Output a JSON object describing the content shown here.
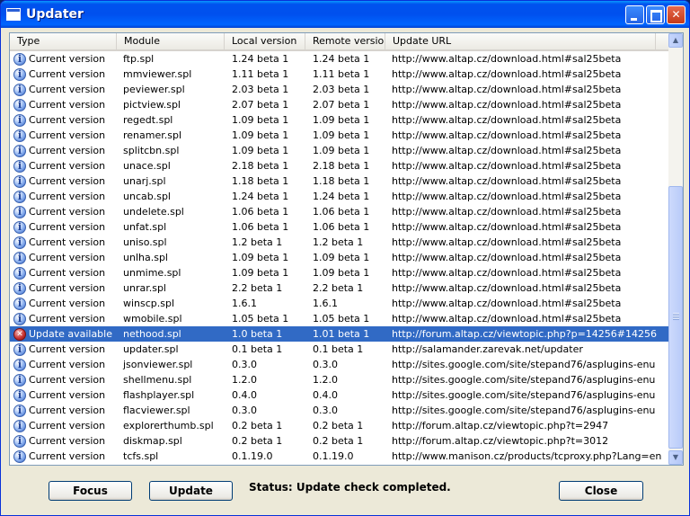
{
  "window": {
    "title": "Updater"
  },
  "titlebar": {
    "min": "",
    "max": "",
    "close": "✕"
  },
  "columns": [
    "Type",
    "Module",
    "Local version",
    "Remote version",
    "Update URL"
  ],
  "rows": [
    {
      "type": "Current version",
      "icon": "info-icon",
      "module": "ftp.spl",
      "local": "1.24 beta 1",
      "remote": "1.24 beta 1",
      "url": "http://www.altap.cz/download.html#sal25beta"
    },
    {
      "type": "Current version",
      "icon": "info-icon",
      "module": "mmviewer.spl",
      "local": "1.11 beta 1",
      "remote": "1.11 beta 1",
      "url": "http://www.altap.cz/download.html#sal25beta"
    },
    {
      "type": "Current version",
      "icon": "info-icon",
      "module": "peviewer.spl",
      "local": "2.03 beta 1",
      "remote": "2.03 beta 1",
      "url": "http://www.altap.cz/download.html#sal25beta"
    },
    {
      "type": "Current version",
      "icon": "info-icon",
      "module": "pictview.spl",
      "local": "2.07 beta 1",
      "remote": "2.07 beta 1",
      "url": "http://www.altap.cz/download.html#sal25beta"
    },
    {
      "type": "Current version",
      "icon": "info-icon",
      "module": "regedt.spl",
      "local": "1.09 beta 1",
      "remote": "1.09 beta 1",
      "url": "http://www.altap.cz/download.html#sal25beta"
    },
    {
      "type": "Current version",
      "icon": "info-icon",
      "module": "renamer.spl",
      "local": "1.09 beta 1",
      "remote": "1.09 beta 1",
      "url": "http://www.altap.cz/download.html#sal25beta"
    },
    {
      "type": "Current version",
      "icon": "info-icon",
      "module": "splitcbn.spl",
      "local": "1.09 beta 1",
      "remote": "1.09 beta 1",
      "url": "http://www.altap.cz/download.html#sal25beta"
    },
    {
      "type": "Current version",
      "icon": "info-icon",
      "module": "unace.spl",
      "local": "2.18 beta 1",
      "remote": "2.18 beta 1",
      "url": "http://www.altap.cz/download.html#sal25beta"
    },
    {
      "type": "Current version",
      "icon": "info-icon",
      "module": "unarj.spl",
      "local": "1.18 beta 1",
      "remote": "1.18 beta 1",
      "url": "http://www.altap.cz/download.html#sal25beta"
    },
    {
      "type": "Current version",
      "icon": "info-icon",
      "module": "uncab.spl",
      "local": "1.24 beta 1",
      "remote": "1.24 beta 1",
      "url": "http://www.altap.cz/download.html#sal25beta"
    },
    {
      "type": "Current version",
      "icon": "info-icon",
      "module": "undelete.spl",
      "local": "1.06 beta 1",
      "remote": "1.06 beta 1",
      "url": "http://www.altap.cz/download.html#sal25beta"
    },
    {
      "type": "Current version",
      "icon": "info-icon",
      "module": "unfat.spl",
      "local": "1.06 beta 1",
      "remote": "1.06 beta 1",
      "url": "http://www.altap.cz/download.html#sal25beta"
    },
    {
      "type": "Current version",
      "icon": "info-icon",
      "module": "uniso.spl",
      "local": "1.2 beta 1",
      "remote": "1.2 beta 1",
      "url": "http://www.altap.cz/download.html#sal25beta"
    },
    {
      "type": "Current version",
      "icon": "info-icon",
      "module": "unlha.spl",
      "local": "1.09 beta 1",
      "remote": "1.09 beta 1",
      "url": "http://www.altap.cz/download.html#sal25beta"
    },
    {
      "type": "Current version",
      "icon": "info-icon",
      "module": "unmime.spl",
      "local": "1.09 beta 1",
      "remote": "1.09 beta 1",
      "url": "http://www.altap.cz/download.html#sal25beta"
    },
    {
      "type": "Current version",
      "icon": "info-icon",
      "module": "unrar.spl",
      "local": "2.2 beta 1",
      "remote": "2.2 beta 1",
      "url": "http://www.altap.cz/download.html#sal25beta"
    },
    {
      "type": "Current version",
      "icon": "info-icon",
      "module": "winscp.spl",
      "local": "1.6.1",
      "remote": "1.6.1",
      "url": "http://www.altap.cz/download.html#sal25beta"
    },
    {
      "type": "Current version",
      "icon": "info-icon",
      "module": "wmobile.spl",
      "local": "1.05 beta 1",
      "remote": "1.05 beta 1",
      "url": "http://www.altap.cz/download.html#sal25beta"
    },
    {
      "type": "Update available",
      "icon": "error-icon",
      "module": "nethood.spl",
      "local": "1.0 beta 1",
      "remote": "1.01 beta 1",
      "url": "http://forum.altap.cz/viewtopic.php?p=14256#14256",
      "selected": true
    },
    {
      "type": "Current version",
      "icon": "info-icon",
      "module": "updater.spl",
      "local": "0.1 beta 1",
      "remote": "0.1 beta 1",
      "url": "http://salamander.zarevak.net/updater"
    },
    {
      "type": "Current version",
      "icon": "info-icon",
      "module": "jsonviewer.spl",
      "local": "0.3.0",
      "remote": "0.3.0",
      "url": "http://sites.google.com/site/stepand76/asplugins-enu"
    },
    {
      "type": "Current version",
      "icon": "info-icon",
      "module": "shellmenu.spl",
      "local": "1.2.0",
      "remote": "1.2.0",
      "url": "http://sites.google.com/site/stepand76/asplugins-enu"
    },
    {
      "type": "Current version",
      "icon": "info-icon",
      "module": "flashplayer.spl",
      "local": "0.4.0",
      "remote": "0.4.0",
      "url": "http://sites.google.com/site/stepand76/asplugins-enu"
    },
    {
      "type": "Current version",
      "icon": "info-icon",
      "module": "flacviewer.spl",
      "local": "0.3.0",
      "remote": "0.3.0",
      "url": "http://sites.google.com/site/stepand76/asplugins-enu"
    },
    {
      "type": "Current version",
      "icon": "info-icon",
      "module": "explorerthumb.spl",
      "local": "0.2 beta 1",
      "remote": "0.2 beta 1",
      "url": "http://forum.altap.cz/viewtopic.php?t=2947"
    },
    {
      "type": "Current version",
      "icon": "info-icon",
      "module": "diskmap.spl",
      "local": "0.2 beta 1",
      "remote": "0.2 beta 1",
      "url": "http://forum.altap.cz/viewtopic.php?t=3012"
    },
    {
      "type": "Current version",
      "icon": "info-icon",
      "module": "tcfs.spl",
      "local": "0.1.19.0",
      "remote": "0.1.19.0",
      "url": "http://www.manison.cz/products/tcproxy.php?Lang=en"
    }
  ],
  "buttons": {
    "focus": "Focus",
    "update": "Update",
    "close": "Close"
  },
  "status": "Status: Update check completed.",
  "colors": {
    "selection": "#316ac5",
    "titlebar": "#0054e3",
    "face": "#ece9d8"
  }
}
